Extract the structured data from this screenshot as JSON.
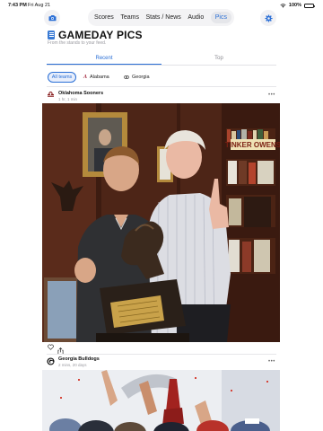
{
  "status_bar": {
    "time": "7:43 PM",
    "date": "Fri Aug 21",
    "battery": "100%"
  },
  "nav": {
    "tabs": [
      "Scores",
      "Teams",
      "Stats / News",
      "Audio",
      "Pics"
    ],
    "active_tab": "Pics",
    "icons": {
      "camera": "camera-icon",
      "settings": "gear-icon"
    }
  },
  "header": {
    "title": "GAMEDAY PICS",
    "subtitle": "From the stands to your feed."
  },
  "segments": {
    "recent": "Recent",
    "top": "Top",
    "active": "Recent"
  },
  "filters": {
    "all": "All teams",
    "alabama": "Alabama",
    "georgia": "Georgia",
    "selected": "All teams"
  },
  "posts": [
    {
      "team": "Oklahoma Sooners",
      "time": "1 hr, 1 min",
      "logo": "OU-logo",
      "more": "•••"
    },
    {
      "team": "Georgia Bulldogs",
      "time": "2 mins, 20 days",
      "logo": "G-logo",
      "more": "•••"
    }
  ],
  "colors": {
    "accent": "#2a6fd6",
    "ou": "#841617",
    "bama": "#9e1b32"
  }
}
